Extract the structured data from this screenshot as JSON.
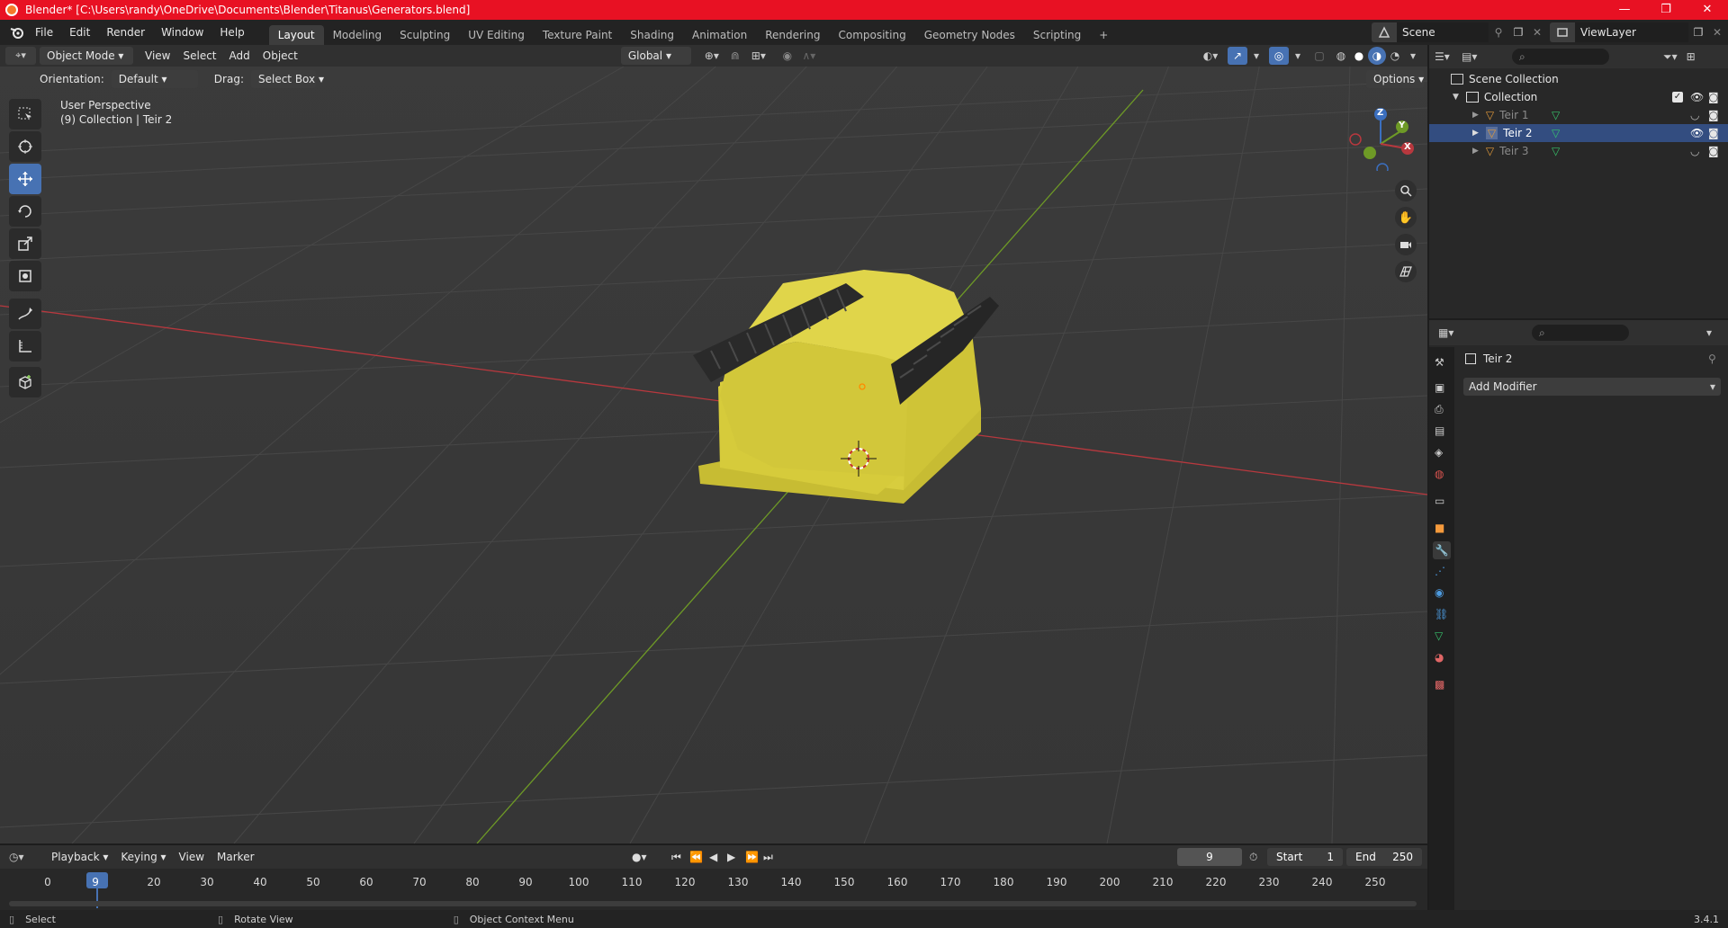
{
  "titlebar": {
    "title": "Blender* [C:\\Users\\randy\\OneDrive\\Documents\\Blender\\Titanus\\Generators.blend]",
    "minimize": "—",
    "restore": "❐",
    "close": "✕"
  },
  "menu": [
    "File",
    "Edit",
    "Render",
    "Window",
    "Help"
  ],
  "workspaces": [
    "Layout",
    "Modeling",
    "Sculpting",
    "UV Editing",
    "Texture Paint",
    "Shading",
    "Animation",
    "Rendering",
    "Compositing",
    "Geometry Nodes",
    "Scripting"
  ],
  "workspace_add": "+",
  "scene": {
    "name": "Scene",
    "viewlayer": "ViewLayer"
  },
  "viewport_header": {
    "mode": "Object Mode",
    "view": "View",
    "select": "Select",
    "add": "Add",
    "object": "Object",
    "transform_orientation": "Global",
    "options": "Options"
  },
  "tool_settings": {
    "orientation_label": "Orientation:",
    "orientation_value": "Default",
    "drag_label": "Drag:",
    "drag_value": "Select Box"
  },
  "viewport_overlay": {
    "perspective": "User Perspective",
    "collection_info": "(9) Collection | Teir 2"
  },
  "gizmo": {
    "x": "X",
    "y": "Y",
    "z": "Z"
  },
  "outliner": {
    "scene_collection": "Scene Collection",
    "collection": "Collection",
    "objects": [
      {
        "name": "Teir 1",
        "selected": false
      },
      {
        "name": "Teir 2",
        "selected": true
      },
      {
        "name": "Teir 3",
        "selected": false
      }
    ]
  },
  "properties": {
    "object_name": "Teir 2",
    "add_modifier": "Add Modifier"
  },
  "timeline": {
    "playback": "Playback",
    "keying": "Keying",
    "view": "View",
    "marker": "Marker",
    "current_frame": "9",
    "start_label": "Start",
    "start_value": "1",
    "end_label": "End",
    "end_value": "250",
    "ticks": [
      "0",
      "9",
      "20",
      "30",
      "40",
      "50",
      "60",
      "70",
      "80",
      "90",
      "100",
      "110",
      "120",
      "130",
      "140",
      "150",
      "160",
      "170",
      "180",
      "190",
      "200",
      "210",
      "220",
      "230",
      "240",
      "250"
    ]
  },
  "statusbar": {
    "select": "Select",
    "rotate_view": "Rotate View",
    "object_context_menu": "Object Context Menu",
    "version": "3.4.1"
  },
  "colors": {
    "accent": "#4772b3",
    "object_yellow": "#d8cd3e",
    "axis_x": "#b8383e",
    "axis_y": "#6e9a26",
    "titlebar": "#e81123"
  }
}
